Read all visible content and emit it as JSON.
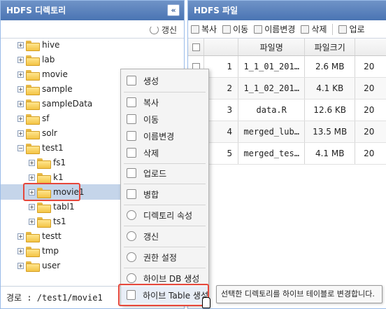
{
  "left_panel": {
    "title": "HDFS 디렉토리",
    "collapse_glyph": "«",
    "refresh_label": "갱신",
    "tree": [
      {
        "label": "hive",
        "level": 0,
        "expanded": false
      },
      {
        "label": "lab",
        "level": 0,
        "expanded": false
      },
      {
        "label": "movie",
        "level": 0,
        "expanded": false
      },
      {
        "label": "sample",
        "level": 0,
        "expanded": false
      },
      {
        "label": "sampleData",
        "level": 0,
        "expanded": false
      },
      {
        "label": "sf",
        "level": 0,
        "expanded": false
      },
      {
        "label": "solr",
        "level": 0,
        "expanded": false
      },
      {
        "label": "test1",
        "level": 0,
        "expanded": true
      },
      {
        "label": "fs1",
        "level": 1,
        "expanded": false
      },
      {
        "label": "k1",
        "level": 1,
        "expanded": false
      },
      {
        "label": "movie1",
        "level": 1,
        "expanded": false,
        "selected": true
      },
      {
        "label": "tabl1",
        "level": 1,
        "expanded": false
      },
      {
        "label": "ts1",
        "level": 1,
        "expanded": false
      },
      {
        "label": "testt",
        "level": 0,
        "expanded": false
      },
      {
        "label": "tmp",
        "level": 0,
        "expanded": false
      },
      {
        "label": "user",
        "level": 0,
        "expanded": false
      }
    ],
    "path_label": "경로",
    "path_value": "/test1/movie1"
  },
  "right_panel": {
    "title": "HDFS 파일",
    "toolbar": {
      "copy": "복사",
      "move": "이동",
      "rename": "이름변경",
      "delete": "삭제",
      "upload": "업로"
    },
    "columns": {
      "name": "파일명",
      "size": "파일크기"
    },
    "rows": [
      {
        "num": "1",
        "name": "1_1_01_201…",
        "size": "2.6 MB",
        "date": "20"
      },
      {
        "num": "2",
        "name": "1_1_02_201…",
        "size": "4.1 KB",
        "date": "20"
      },
      {
        "num": "3",
        "name": "data.R",
        "size": "12.6 KB",
        "date": "20"
      },
      {
        "num": "4",
        "name": "merged_lub…",
        "size": "13.5 MB",
        "date": "20"
      },
      {
        "num": "5",
        "name": "merged_tes…",
        "size": "4.1 MB",
        "date": "20"
      }
    ]
  },
  "context_menu": {
    "items": {
      "create": "생성",
      "copy": "복사",
      "move": "이동",
      "rename": "이름변경",
      "delete": "삭제",
      "upload": "업로드",
      "merge": "병합",
      "dir_props": "디렉토리 속성",
      "refresh": "갱신",
      "permissions": "권한 설정",
      "hive_db": "하이브 DB 생성",
      "hive_table": "하이브 Table 생성"
    }
  },
  "tooltip": {
    "text": "선택한 디렉토리를 하이브 테이블로 변경합니다."
  },
  "colors": {
    "header_blue": "#4a74b3",
    "highlight_red": "#e6473b",
    "selection": "#c5d5ea"
  }
}
